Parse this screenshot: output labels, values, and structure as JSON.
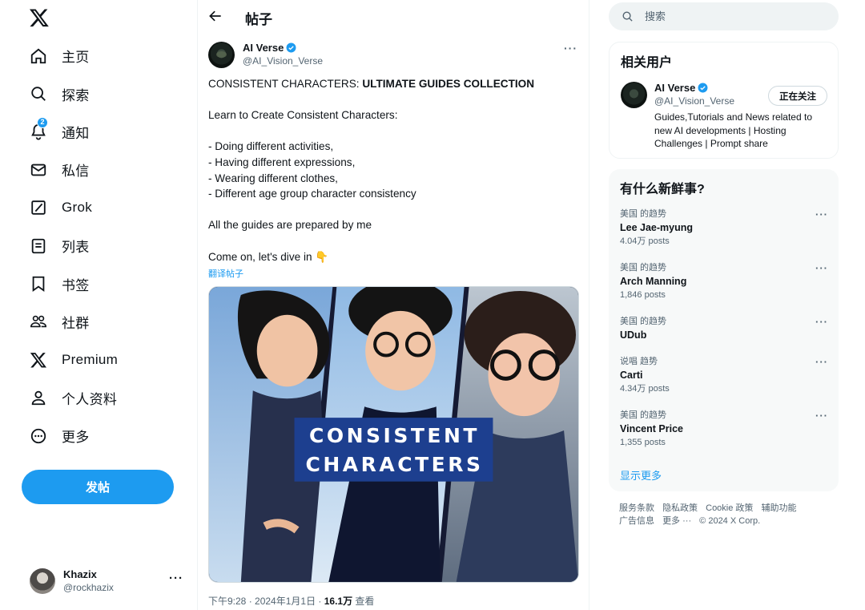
{
  "sidebar": {
    "items": [
      {
        "label": "主页",
        "icon": "home-icon"
      },
      {
        "label": "探索",
        "icon": "search-icon"
      },
      {
        "label": "通知",
        "icon": "bell-icon",
        "badge": "2"
      },
      {
        "label": "私信",
        "icon": "mail-icon"
      },
      {
        "label": "Grok",
        "icon": "grok-icon"
      },
      {
        "label": "列表",
        "icon": "list-icon"
      },
      {
        "label": "书签",
        "icon": "bookmark-icon"
      },
      {
        "label": "社群",
        "icon": "communities-icon"
      },
      {
        "label": "Premium",
        "icon": "x-logo-icon"
      },
      {
        "label": "个人资料",
        "icon": "profile-icon"
      },
      {
        "label": "更多",
        "icon": "more-circle-icon"
      }
    ],
    "post_button": "发帖",
    "account": {
      "name": "Khazix",
      "handle": "@rockhazix",
      "more": "···"
    }
  },
  "main": {
    "title": "帖子",
    "author": {
      "name": "AI Verse",
      "handle": "@AI_Vision_Verse"
    },
    "more": "···",
    "body": {
      "line1_plain": "CONSISTENT CHARACTERS: ",
      "line1_bold": "ULTIMATE GUIDES COLLECTION",
      "line2": "Learn to Create Consistent Characters:",
      "line3": "- Doing different activities,",
      "line4": "- Having different expressions,",
      "line5": "- Wearing different clothes,",
      "line6": "- Different age group character consistency",
      "line7": "All the guides are prepared by me",
      "line8": "Come on, let's dive in 👇"
    },
    "translate": "翻译帖子",
    "media_caption": [
      "CONSISTENT",
      "CHARACTERS"
    ],
    "meta": {
      "time": "下午9:28 · 2024年1月1日 · ",
      "views": "16.1万",
      "views_label": " 查看"
    }
  },
  "right": {
    "search_placeholder": "搜索",
    "related": {
      "title": "相关用户",
      "user": {
        "name": "AI Verse",
        "handle": "@AI_Vision_Verse",
        "bio": "Guides,Tutorials and News related to new AI developments | Hosting Challenges | Prompt share",
        "button": "正在关注"
      }
    },
    "trends": {
      "title": "有什么新鲜事?",
      "items": [
        {
          "context": "美国 的趋势",
          "name": "Lee Jae-myung",
          "count": "4.04万 posts"
        },
        {
          "context": "美国 的趋势",
          "name": "Arch Manning",
          "count": "1,846 posts"
        },
        {
          "context": "美国 的趋势",
          "name": "UDub",
          "count": ""
        },
        {
          "context": "说唱 趋势",
          "name": "Carti",
          "count": "4.34万 posts"
        },
        {
          "context": "美国 的趋势",
          "name": "Vincent Price",
          "count": "1,355 posts"
        }
      ],
      "show_more": "显示更多"
    },
    "footer": {
      "links": [
        "服务条款",
        "隐私政策",
        "Cookie 政策",
        "辅助功能",
        "广告信息",
        "更多 ···",
        "© 2024 X Corp."
      ]
    }
  },
  "colors": {
    "accent": "#1d9bf0",
    "text": "#0f1419",
    "muted": "#536471"
  }
}
